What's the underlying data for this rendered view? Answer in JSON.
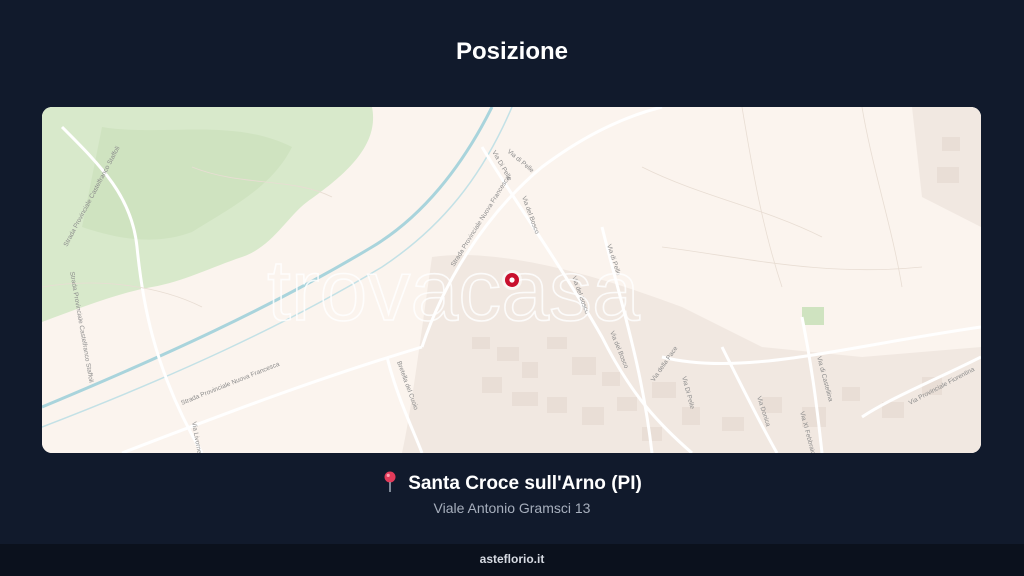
{
  "header": {
    "title": "Posizione"
  },
  "map": {
    "watermark": "trovacasa",
    "marker_icon": "location-marker-icon",
    "road_labels": [
      "Strada Provinciale Nuova Francesca",
      "Strada Provinciale Nuova Francesca",
      "Via di Pelle",
      "Via del Bosco",
      "Via del Bosco",
      "Via del Bosco",
      "Via di Pelle",
      "Via Di Pelle",
      "Via della Pace",
      "Strada Provinciale Castelfranco Staffoli",
      "Strada Provinciale Castelfranco Staffoli",
      "Bretella del Cuoio",
      "Via Livornese",
      "Via Di Pelle",
      "Via Donica",
      "Via di Castellina",
      "Via XI Febbraio",
      "Via Provinciale Fiorentina"
    ],
    "colors": {
      "land": "#fbf4ee",
      "forest": "#cfe3c0",
      "water": "#a9d4dc",
      "marker": "#c8102e"
    }
  },
  "location": {
    "pin_icon": "map-pin-icon",
    "city": "Santa Croce sull'Arno (PI)",
    "address": "Viale Antonio Gramsci 13"
  },
  "footer": {
    "site": "asteflorio.it"
  }
}
